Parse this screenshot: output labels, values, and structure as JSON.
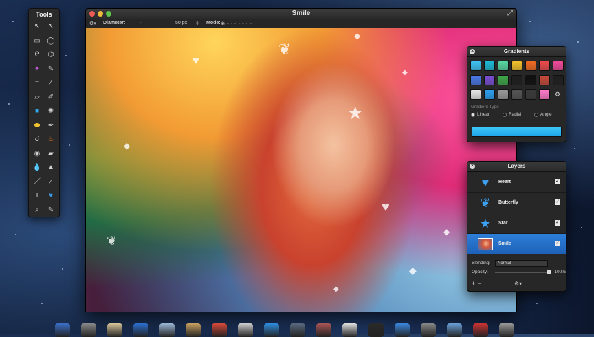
{
  "colors": {
    "accent": "#1e62b8",
    "panel": "#272727",
    "gradient_start": "#3cc6f7"
  },
  "tools": {
    "title": "Tools",
    "items": [
      {
        "name": "select-arrow",
        "glyph": "↖"
      },
      {
        "name": "direct-select",
        "glyph": "↖"
      },
      {
        "name": "rect-select",
        "glyph": "▭"
      },
      {
        "name": "ellipse-select",
        "glyph": "◯"
      },
      {
        "name": "lasso",
        "glyph": "ᘓ"
      },
      {
        "name": "polygon-lasso",
        "glyph": "⌬"
      },
      {
        "name": "magic-wand",
        "glyph": "✦"
      },
      {
        "name": "eyedropper",
        "glyph": "✎"
      },
      {
        "name": "crop",
        "glyph": "⌗"
      },
      {
        "name": "slice",
        "glyph": "∕"
      },
      {
        "name": "eraser",
        "glyph": "▱"
      },
      {
        "name": "brush",
        "glyph": "✐"
      },
      {
        "name": "fill",
        "glyph": "■"
      },
      {
        "name": "stamp",
        "glyph": "✺"
      },
      {
        "name": "sponge",
        "glyph": "⬬"
      },
      {
        "name": "pen",
        "glyph": "✒"
      },
      {
        "name": "smudge",
        "glyph": "☌"
      },
      {
        "name": "burn",
        "glyph": "♨"
      },
      {
        "name": "eye",
        "glyph": "◉"
      },
      {
        "name": "eraser-2",
        "glyph": "▰"
      },
      {
        "name": "drop",
        "glyph": "💧"
      },
      {
        "name": "sharpen",
        "glyph": "▲"
      },
      {
        "name": "line",
        "glyph": "／"
      },
      {
        "name": "pencil",
        "glyph": "∕"
      },
      {
        "name": "text",
        "glyph": "T"
      },
      {
        "name": "shape-heart",
        "glyph": "♥"
      },
      {
        "name": "zoom",
        "glyph": "⌕"
      },
      {
        "name": "hand-brush",
        "glyph": "✎"
      }
    ]
  },
  "window": {
    "title": "Smile",
    "toolbar": {
      "diameter_label": "Diameter:",
      "diameter_value": "50 px",
      "mode_label": "Mode:"
    }
  },
  "gradients": {
    "title": "Gradients",
    "swatches": [
      "#3ec3f5",
      "#1db9d6",
      "#57d8a2",
      "#f4c02a",
      "#f36b22",
      "#ee4b4b",
      "#f14a9a",
      "#4a78e8",
      "#7b4fd6",
      "#3fa84a",
      "#1d1d1d",
      "#0e0e0e",
      "#c84b3a",
      "#1e1e1e",
      "#e8e8e8",
      "#2b9ff0",
      "#9a9a9a",
      "#555555",
      "#3a3a3a",
      "#ff7acb"
    ],
    "type_label": "Gradient Type",
    "types": [
      "Linear",
      "Radial",
      "Angle"
    ],
    "selected_type": "Linear"
  },
  "layers": {
    "title": "Layers",
    "items": [
      {
        "name": "Heart",
        "icon": "heart-icon",
        "glyph": "♥",
        "visible": true,
        "selected": false
      },
      {
        "name": "Butterfly",
        "icon": "butterfly-icon",
        "glyph": "❦",
        "visible": true,
        "selected": false
      },
      {
        "name": "Star",
        "icon": "star-icon",
        "glyph": "★",
        "visible": true,
        "selected": false
      },
      {
        "name": "Smile",
        "icon": "photo-thumbnail",
        "glyph": "",
        "visible": true,
        "selected": true
      }
    ],
    "blending_label": "Blending:",
    "blending_value": "Normal",
    "opacity_label": "Opacity:",
    "opacity_value": "100%",
    "opacity": 1.0
  }
}
